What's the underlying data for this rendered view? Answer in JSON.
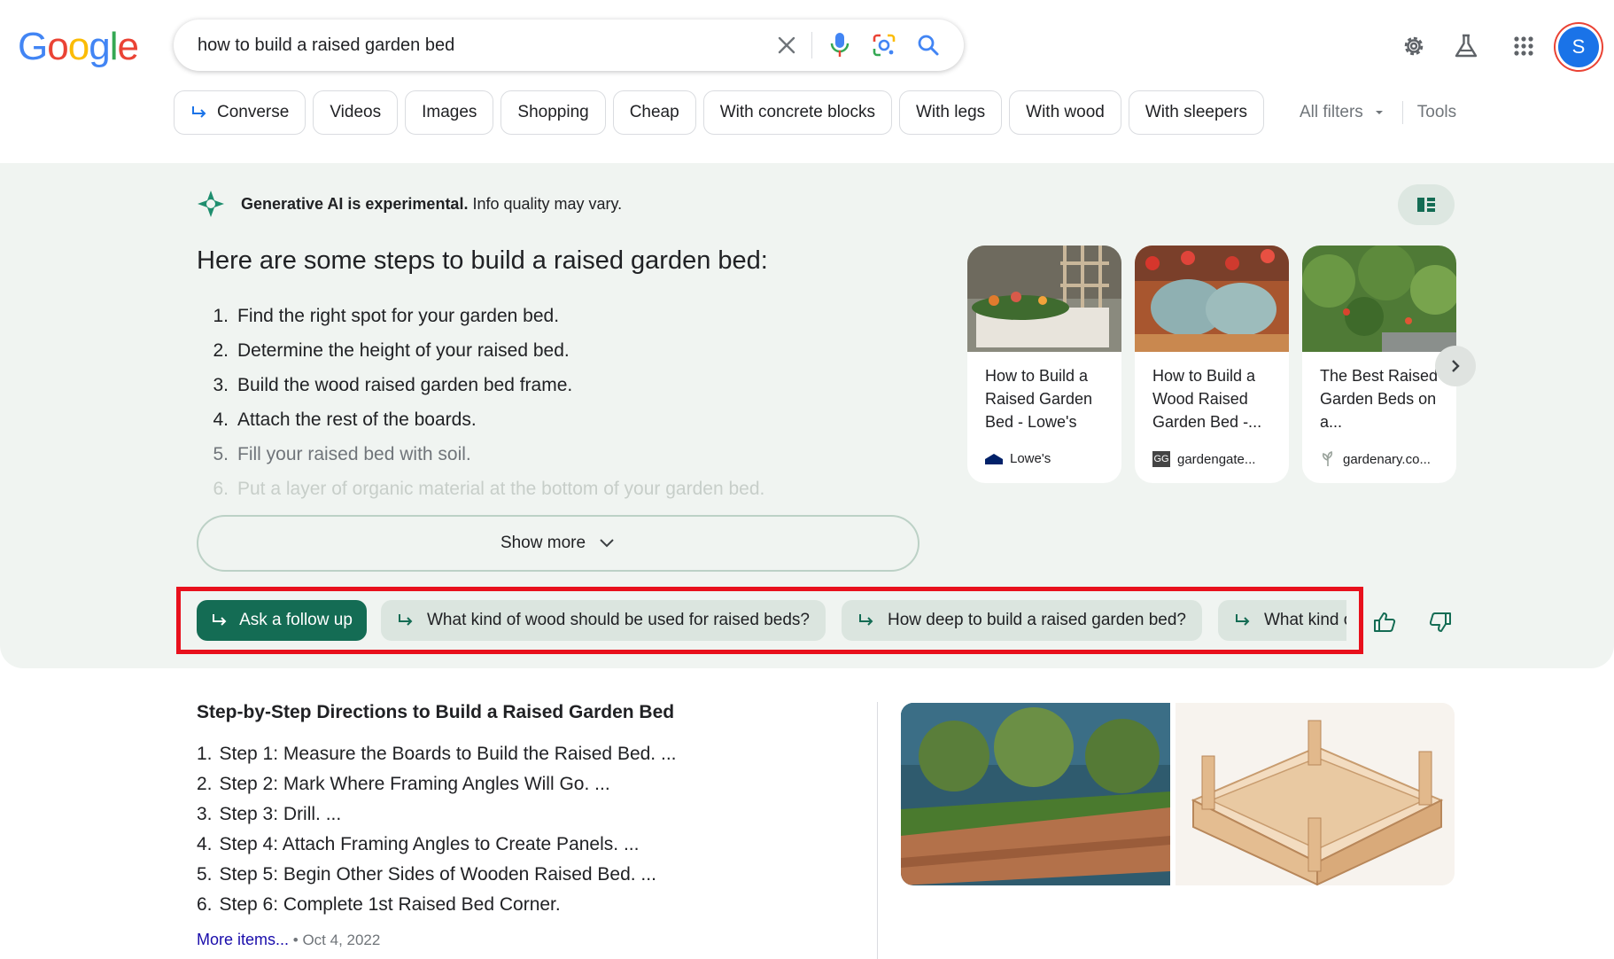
{
  "header": {
    "logo_text": "Google",
    "search_query": "how to build a raised garden bed",
    "avatar_letter": "S",
    "icons": [
      "clear-icon",
      "microphone-icon",
      "lens-icon",
      "search-icon",
      "settings-icon",
      "labs-flask-icon",
      "apps-grid-icon"
    ]
  },
  "chips": [
    "Converse",
    "Videos",
    "Images",
    "Shopping",
    "Cheap",
    "With concrete blocks",
    "With legs",
    "With wood",
    "With sleepers"
  ],
  "filters": {
    "all_filters": "All filters",
    "tools": "Tools"
  },
  "ai_overview": {
    "notice_bold": "Generative AI is experimental.",
    "notice_rest": " Info quality may vary.",
    "title": "Here are some steps to build a raised garden bed:",
    "steps": [
      "Find the right spot for your garden bed.",
      "Determine the height of your raised bed.",
      "Build the wood raised garden bed frame.",
      "Attach the rest of the boards.",
      "Fill your raised bed with soil.",
      "Put a layer of organic material at the bottom of your garden bed."
    ],
    "show_more": "Show more",
    "cards": [
      {
        "title": "How to Build a Raised Garden Bed - Lowe's",
        "source": "Lowe's"
      },
      {
        "title": "How to Build a Wood Raised Garden Bed -...",
        "source": "gardengate..."
      },
      {
        "title": "The Best Raised Garden Beds on a...",
        "source": "gardenary.co..."
      }
    ],
    "ask_follow_up": "Ask a follow up",
    "follow_ups": [
      "What kind of wood should be used for raised beds?",
      "How deep to build a raised garden bed?",
      "What kind of soil"
    ]
  },
  "result": {
    "title": "Step-by-Step Directions to Build a Raised Garden Bed",
    "steps": [
      "Step 1: Measure the Boards to Build the Raised Bed. ...",
      "Step 2: Mark Where Framing Angles Will Go. ...",
      "Step 3: Drill. ...",
      "Step 4: Attach Framing Angles to Create Panels. ...",
      "Step 5: Begin Other Sides of Wooden Raised Bed. ...",
      "Step 6: Complete 1st Raised Bed Corner."
    ],
    "more_items": "More items...",
    "date": "Oct 4, 2022"
  }
}
